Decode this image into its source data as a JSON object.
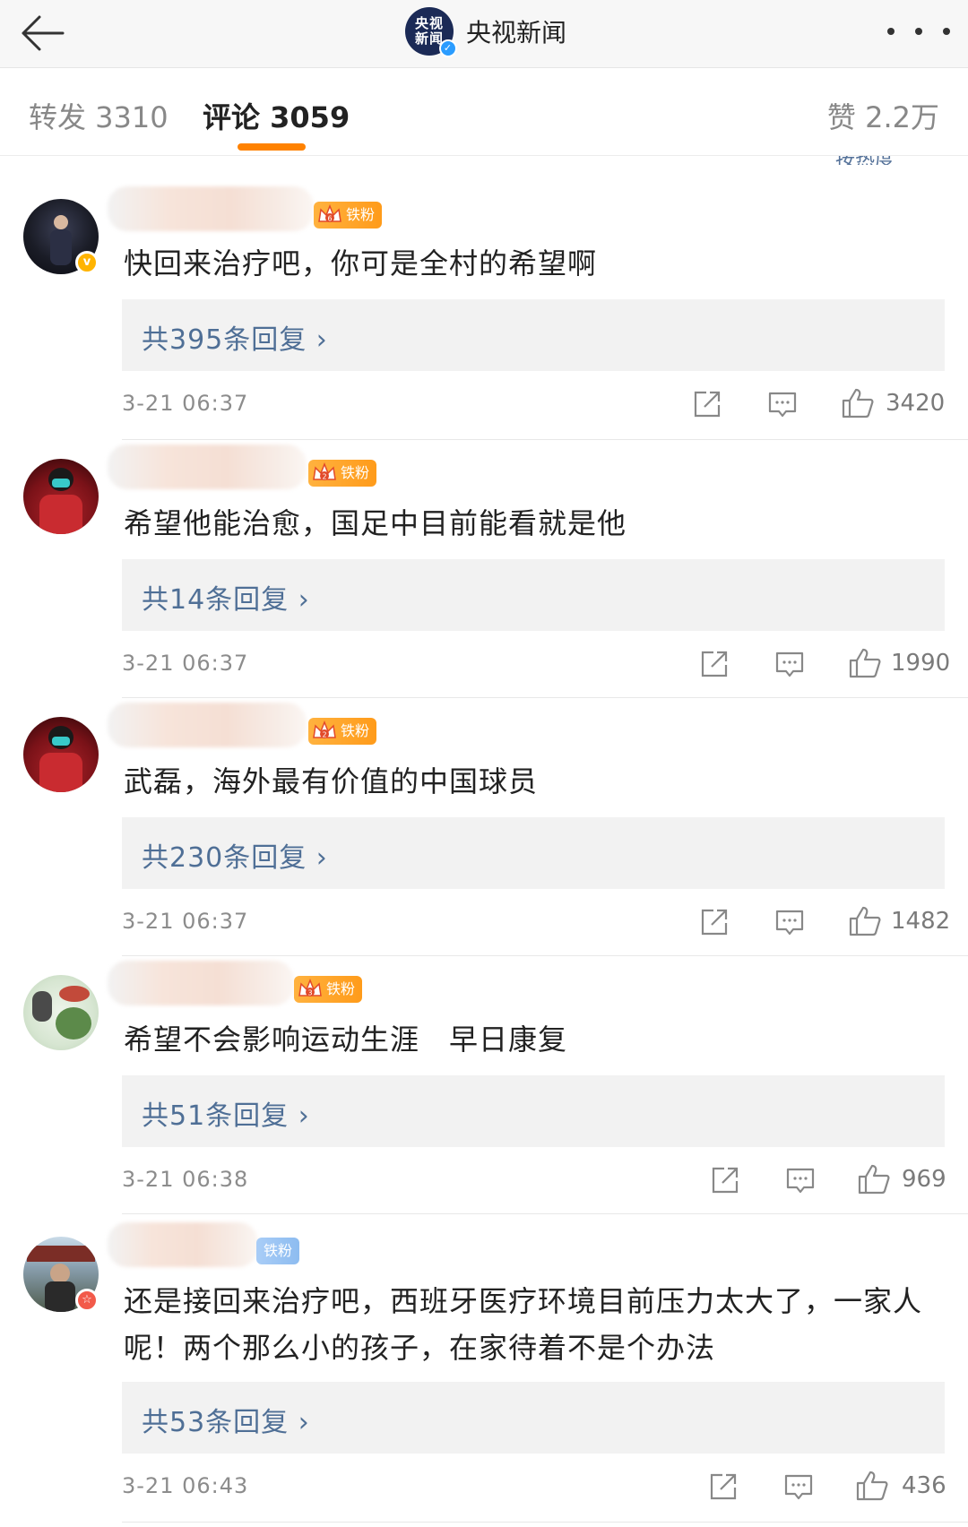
{
  "header": {
    "account_name": "央视新闻",
    "logo_line1": "央视",
    "logo_line2": "新闻"
  },
  "tabs": [
    {
      "label": "转发 3310"
    },
    {
      "label": "评论 3059"
    },
    {
      "label": "赞 2.2万"
    }
  ],
  "sort_hint": "按热度",
  "colors": {
    "accent": "#ff8200",
    "link": "#4f6f96",
    "fan_badge": "#ff9b1a"
  },
  "comments": [
    {
      "badge": "铁粉",
      "badge_level": "6",
      "text": "快回来治疗吧，你可是全村的希望啊",
      "replies": "共395条回复 ›",
      "time": "3-21 06:37",
      "likes": "3420",
      "avatar_badge": "v"
    },
    {
      "badge": "铁粉",
      "badge_level": "2",
      "text": "希望他能治愈，国足中目前能看就是他",
      "replies": "共14条回复 ›",
      "time": "3-21 06:37",
      "likes": "1990"
    },
    {
      "badge": "铁粉",
      "badge_level": "2",
      "text": "武磊，海外最有价值的中国球员",
      "replies": "共230条回复 ›",
      "time": "3-21 06:37",
      "likes": "1482"
    },
    {
      "badge": "铁粉",
      "badge_level": "3",
      "text": "希望不会影响运动生涯　早日康复",
      "replies": "共51条回复 ›",
      "time": "3-21 06:38",
      "likes": "969"
    },
    {
      "badge": "铁粉",
      "text": "还是接回来治疗吧，西班牙医疗环境目前压力太大了，一家人呢！两个那么小的孩子，在家待着不是个办法",
      "replies": "共53条回复 ›",
      "time": "3-21 06:43",
      "likes": "436",
      "avatar_badge": "☆"
    }
  ]
}
